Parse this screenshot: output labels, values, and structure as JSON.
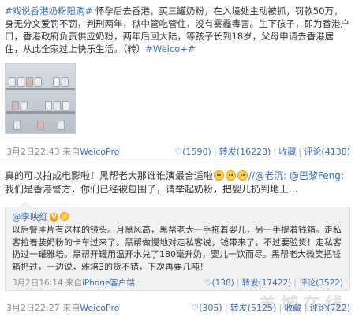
{
  "post1": {
    "hashtag": "#戏说香港奶粉限购#",
    "body": " 怀孕后去香港，买三罐奶粉，在入境处主动被抓，罚款50万，身无分文爱罚不罚，判刑两年，狱中管吃管住，没有雾霾毒害。生下孩子，即为香港户口，香港政府负责供应奶粉，两年后回大陆，等孩子长到18岁，父母申请去香港居住，从此全家过上快乐生活。（转）",
    "tag2": "#Weico+#",
    "time": "3月2日22:43",
    "source_prefix": "来自",
    "source": "WeicoPro",
    "likes": "(1590)",
    "repost": "转发(16223)",
    "fav": "收藏",
    "comments": "评论(4138)"
  },
  "post2": {
    "body": "真的可以拍成电影啦！黑帮老大那谁谁演最合适啦",
    "mention1": "//@老沉:",
    "mention2": "@巴黎Feng",
    "body2": ":我们是香港警方，你们已经被包围了，请举起奶粉，把婴儿扔到地上...",
    "quote": {
      "author": "@李映红",
      "badge": "V",
      "text": "以后警匪片有这样的镜头。月黑风高，黑帮老大一手拖着婴儿，另一手提着钱箱。走私客拉着装奶粉的卡车过来了。黑帮做慢地对走私客说，钱带来了，不过要验货！走私客扔过一罐雅培。黑帮开罐用温开水兑了180毫升奶，婴儿一饮而尽。黑帮老大微笑把钱箱扔过，一边说，雅培3的货不错，下次再要几吨！",
      "time": "3月2日16:14",
      "source_prefix": "来自",
      "source": "iPhone客户端",
      "likes": "(138)",
      "repost": "转发(17422)",
      "comments": "评论(3522)"
    },
    "time": "3月2日22:27",
    "source_prefix": "来自",
    "source": "WeicoPro",
    "likes": "(305)",
    "repost": "转发(5125)",
    "fav": "收藏",
    "comments": "评论(722)"
  },
  "watermark": "羊城在线",
  "colors": {
    "link": "#3b6fb7",
    "meta": "#8c8c8c",
    "quote_bg": "#f2f2f2"
  }
}
